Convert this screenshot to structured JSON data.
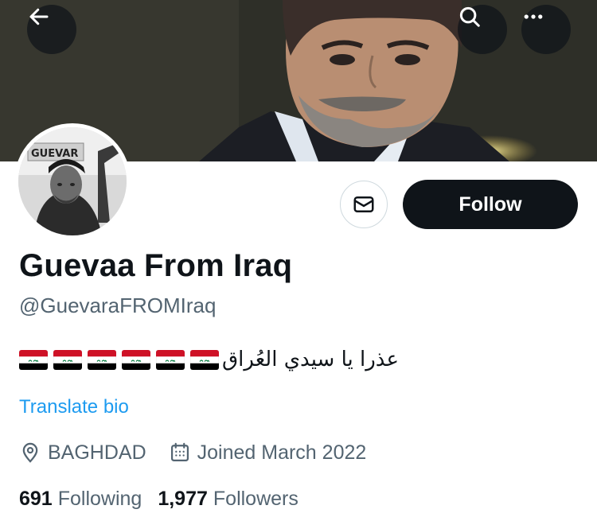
{
  "header": {
    "back_icon": "arrow-left-icon",
    "search_icon": "search-icon",
    "more_icon": "more-horizontal-icon"
  },
  "profile": {
    "display_name": "Guevaa From Iraq",
    "handle": "@GuevaraFROMIraq",
    "avatar_text": "GUEVAR",
    "bio": {
      "flag_count": 6,
      "text": "عذرا يا سيدي العُراق"
    },
    "translate_label": "Translate bio",
    "location": "BAGHDAD",
    "location_icon": "location-pin-icon",
    "joined": "Joined March 2022",
    "joined_icon": "calendar-icon",
    "following_count": "691",
    "following_label": "Following",
    "followers_count": "1,977",
    "followers_label": "Followers"
  },
  "actions": {
    "message_icon": "envelope-icon",
    "follow_label": "Follow"
  },
  "colors": {
    "accent": "#1d9bf0",
    "text_primary": "#0f1419",
    "text_secondary": "#536471",
    "follow_bg": "#0f1419",
    "border": "#cfd9de"
  }
}
